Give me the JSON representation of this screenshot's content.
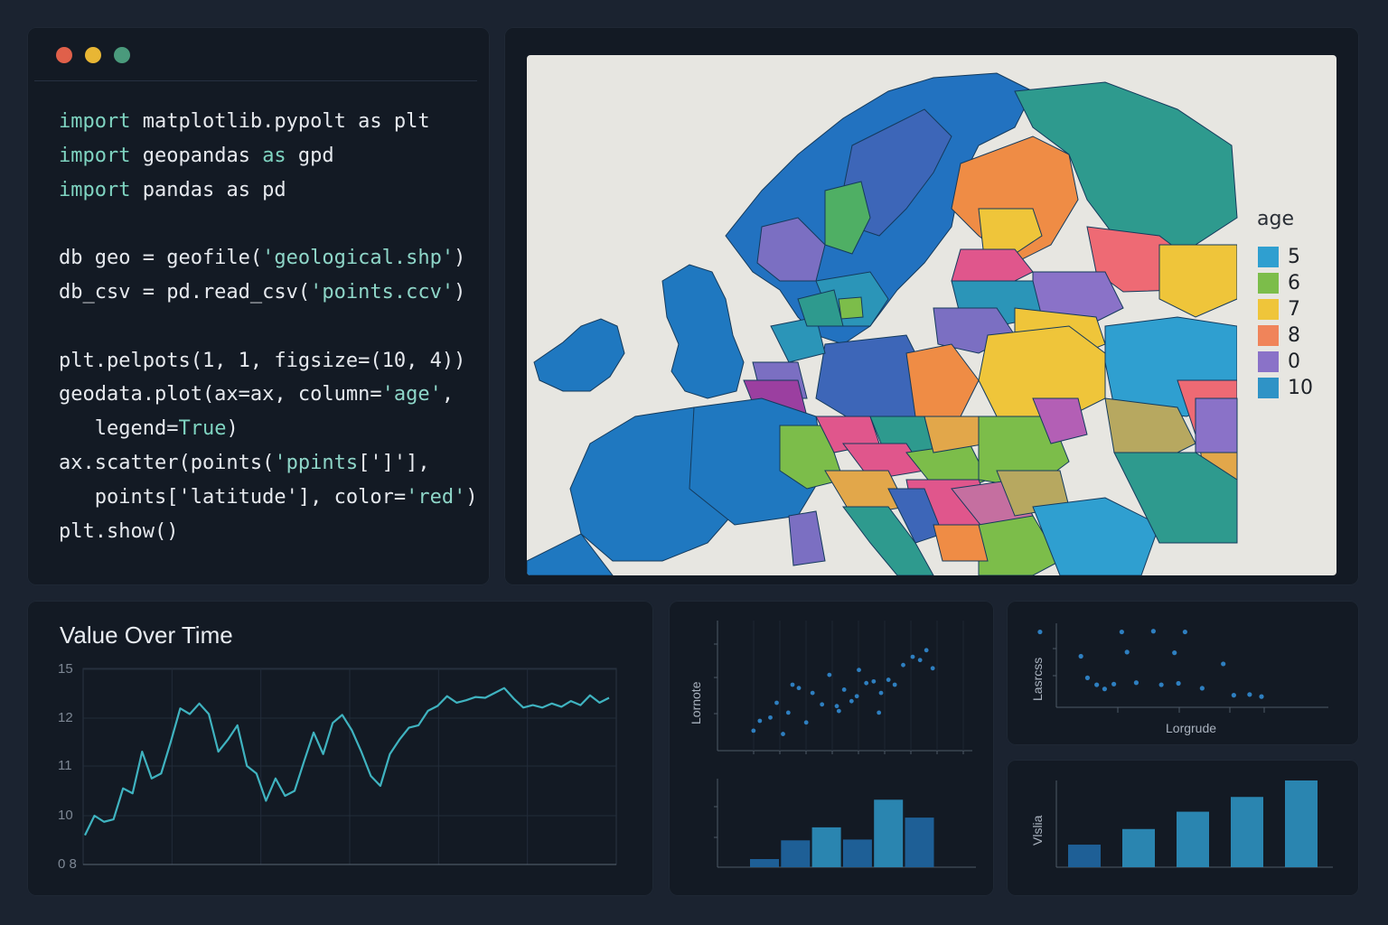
{
  "window": {
    "dots": [
      "#e0604a",
      "#e8b634",
      "#4a9a7c"
    ]
  },
  "code": {
    "lines": [
      [
        {
          "t": "import",
          "c": "kw"
        },
        {
          "t": " matplotlib.pypolt as plt",
          "c": ""
        }
      ],
      [
        {
          "t": "import",
          "c": "kw"
        },
        {
          "t": " geopandas ",
          "c": ""
        },
        {
          "t": "as",
          "c": "kw"
        },
        {
          "t": " gpd",
          "c": ""
        }
      ],
      [
        {
          "t": "import",
          "c": "kw"
        },
        {
          "t": " pandas as pd",
          "c": ""
        }
      ],
      [],
      [
        {
          "t": "db geo = geofile(",
          "c": ""
        },
        {
          "t": "'geological.shp'",
          "c": "str"
        },
        {
          "t": ")",
          "c": ""
        }
      ],
      [
        {
          "t": "db_csv = pd.read_csv(",
          "c": ""
        },
        {
          "t": "'points.ccv'",
          "c": "str"
        },
        {
          "t": ")",
          "c": ""
        }
      ],
      [],
      [
        {
          "t": "plt.pelpots(1, 1, figsize=(10, 4))",
          "c": ""
        }
      ],
      [
        {
          "t": "geodata.plot(ax=ax, column=",
          "c": ""
        },
        {
          "t": "'age'",
          "c": "str"
        },
        {
          "t": ",",
          "c": ""
        }
      ],
      [
        {
          "t": "   legend=",
          "c": ""
        },
        {
          "t": "True",
          "c": "kw"
        },
        {
          "t": ")",
          "c": ""
        }
      ],
      [
        {
          "t": "ax.scatter(points(",
          "c": ""
        },
        {
          "t": "'ppints",
          "c": "str"
        },
        {
          "t": "[']'],",
          "c": ""
        }
      ],
      [
        {
          "t": "   points['latitude'], color=",
          "c": ""
        },
        {
          "t": "'red'",
          "c": "str"
        },
        {
          "t": ")",
          "c": ""
        }
      ],
      [
        {
          "t": "plt.show()",
          "c": ""
        }
      ]
    ]
  },
  "map": {
    "background": "#e7e6e1",
    "legend": {
      "title": "age",
      "items": [
        {
          "label": "5",
          "color": "#2f9fd0"
        },
        {
          "label": "6",
          "color": "#7cbd4a"
        },
        {
          "label": "7",
          "color": "#efc53a"
        },
        {
          "label": "8",
          "color": "#f0845a"
        },
        {
          "label": "0",
          "color": "#8a72c8"
        },
        {
          "label": "10",
          "color": "#2f93c6"
        }
      ]
    }
  },
  "line_chart": {
    "title": "Value Over Time",
    "chart_data": {
      "type": "line",
      "title": "Value Over Time",
      "ylim": [
        8,
        15
      ],
      "yticks": [
        "15",
        "12",
        "11",
        "10",
        "0 8"
      ],
      "ytick_values": [
        15,
        12,
        11,
        10,
        8
      ],
      "grid": true,
      "color": "#3fb3c0",
      "values": [
        9.2,
        10.0,
        9.75,
        9.85,
        10.55,
        10.45,
        11.3,
        10.75,
        10.85,
        11.5,
        12.6,
        12.25,
        12.9,
        12.25,
        11.3,
        11.55,
        11.85,
        11.0,
        10.85,
        10.3,
        10.75,
        10.4,
        10.5,
        11.1,
        11.7,
        11.25,
        11.9,
        12.2,
        11.75,
        11.3,
        10.8,
        10.6,
        11.25,
        11.55,
        11.8,
        11.85,
        12.45,
        12.75,
        13.35,
        12.95,
        13.1,
        13.3,
        13.25,
        13.55,
        13.85,
        13.2,
        12.65,
        12.8,
        12.65,
        12.9,
        12.7,
        13.05,
        12.8,
        13.4,
        12.95,
        13.25
      ]
    }
  },
  "scatter1": {
    "ylabel": "Lornote",
    "chart_data": {
      "type": "scatter",
      "ylabel": "Lornote",
      "color": "#2e7fc0",
      "points": [
        [
          0.5,
          0.5
        ],
        [
          1.1,
          1.1
        ],
        [
          2.1,
          1.3
        ],
        [
          2.7,
          2.2
        ],
        [
          3.3,
          0.3
        ],
        [
          3.8,
          1.6
        ],
        [
          4.2,
          3.3
        ],
        [
          4.8,
          3.1
        ],
        [
          5.5,
          1.0
        ],
        [
          6.1,
          2.8
        ],
        [
          7.0,
          2.1
        ],
        [
          7.7,
          3.9
        ],
        [
          8.6,
          1.7
        ],
        [
          8.4,
          2.0
        ],
        [
          9.1,
          3.0
        ],
        [
          9.8,
          2.3
        ],
        [
          10.3,
          2.6
        ],
        [
          10.5,
          4.2
        ],
        [
          11.2,
          3.4
        ],
        [
          11.9,
          3.5
        ],
        [
          12.6,
          2.8
        ],
        [
          12.4,
          1.6
        ],
        [
          13.3,
          3.6
        ],
        [
          13.9,
          3.3
        ],
        [
          14.7,
          4.5
        ],
        [
          15.6,
          5.0
        ],
        [
          16.3,
          4.8
        ],
        [
          16.9,
          5.4
        ],
        [
          17.5,
          4.3
        ]
      ]
    }
  },
  "bar1": {
    "chart_data": {
      "type": "bar",
      "color_dark": "#1e5f96",
      "color_light": "#2a85b0",
      "values": [
        1,
        3.3,
        4.9,
        3.4,
        8.3,
        6.1
      ]
    }
  },
  "scatter2": {
    "ylabel": "Lasrcss",
    "xlabel": "Lorgrude",
    "chart_data": {
      "type": "scatter",
      "xlabel": "Lorgrude",
      "ylabel": "Lasrcss",
      "color": "#2e7fc0",
      "points": [
        [
          0.2,
          9.8
        ],
        [
          3.3,
          6.3
        ],
        [
          3.8,
          3.2
        ],
        [
          4.5,
          2.2
        ],
        [
          5.1,
          1.6
        ],
        [
          5.8,
          2.3
        ],
        [
          6.4,
          9.8
        ],
        [
          6.8,
          6.9
        ],
        [
          7.5,
          2.5
        ],
        [
          8.8,
          9.9
        ],
        [
          9.4,
          2.2
        ],
        [
          10.4,
          6.8
        ],
        [
          10.7,
          2.4
        ],
        [
          11.2,
          9.8
        ],
        [
          12.5,
          1.7
        ],
        [
          14.1,
          5.2
        ],
        [
          14.9,
          0.7
        ],
        [
          16.1,
          0.8
        ],
        [
          17.0,
          0.5
        ]
      ]
    }
  },
  "bar2": {
    "ylabel": "Vlslia",
    "chart_data": {
      "type": "bar",
      "ylabel": "Vlslia",
      "color_dark": "#1e5f96",
      "color_light": "#2a85b0",
      "values": [
        2.6,
        4.4,
        6.4,
        8.1,
        10
      ]
    }
  }
}
